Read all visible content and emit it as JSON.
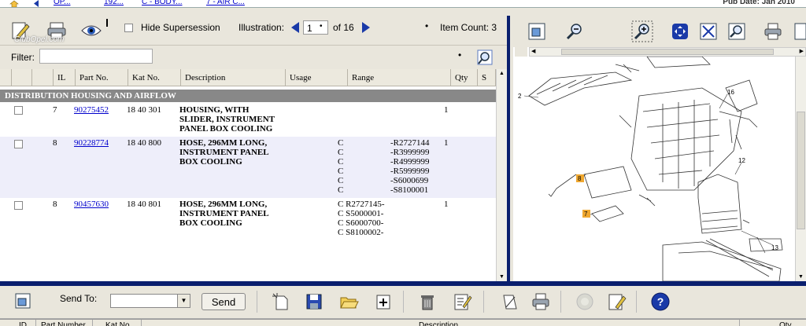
{
  "breadcrumbs": [
    "OP...",
    "192...",
    "C - BODY...",
    "7 - AIR C..."
  ],
  "pub_date": "Pub Date: Jan 2010",
  "toolbar": {
    "hide_supersession": "Hide Supersession",
    "illustration_label": "Illustration:",
    "illustration_value": "1",
    "illustration_of": "of 16",
    "item_count": "Item Count: 3",
    "watermark": "ClubOpel.com"
  },
  "filter": {
    "label": "Filter:",
    "value": ""
  },
  "columns": [
    "IL",
    "Part No.",
    "Kat No.",
    "Description",
    "Usage",
    "Range",
    "Qty",
    "S"
  ],
  "group_title": "DISTRIBUTION HOUSING AND AIRFLOW",
  "rows": [
    {
      "il": "7",
      "part_no": "90275452",
      "kat_no": "18 40 301",
      "description": "HOUSING, WITH\nSLIDER, INSTRUMENT\nPANEL BOX COOLING",
      "usage": "",
      "range_code": "",
      "range_value": "",
      "qty": "1"
    },
    {
      "il": "8",
      "part_no": "90228774",
      "kat_no": "18 40 800",
      "description": "HOSE, 296MM LONG,\nINSTRUMENT PANEL\nBOX COOLING",
      "usage": "",
      "range_code": "C\nC\nC\nC\nC\nC",
      "range_value": "-R2727144\n-R3999999\n-R4999999\n-R5999999\n-S6000699\n-S8100001",
      "qty": "1"
    },
    {
      "il": "8",
      "part_no": "90457630",
      "kat_no": "18 40 801",
      "description": "HOSE, 296MM LONG,\nINSTRUMENT PANEL\nBOX COOLING",
      "usage": "",
      "range_code": "C R2727145-\nC S5000001-\nC S6000700-\nC S8100002-",
      "range_value": "",
      "qty": "1"
    }
  ],
  "illustration_callouts": [
    "2",
    "16",
    "12",
    "8",
    "7",
    "13"
  ],
  "send": {
    "label": "Send To:",
    "select_value": "",
    "button": "Send"
  },
  "bottom_columns": [
    "ID",
    "Part Number",
    "Kat No.",
    "Description",
    "Qty"
  ],
  "colors": {
    "frame": "#0a1f6e",
    "toolbar": "#e9e6dc",
    "group_bar": "#888888",
    "link": "#0000cc",
    "row_alt": "#eeeefa",
    "callout": "#f0a830"
  }
}
